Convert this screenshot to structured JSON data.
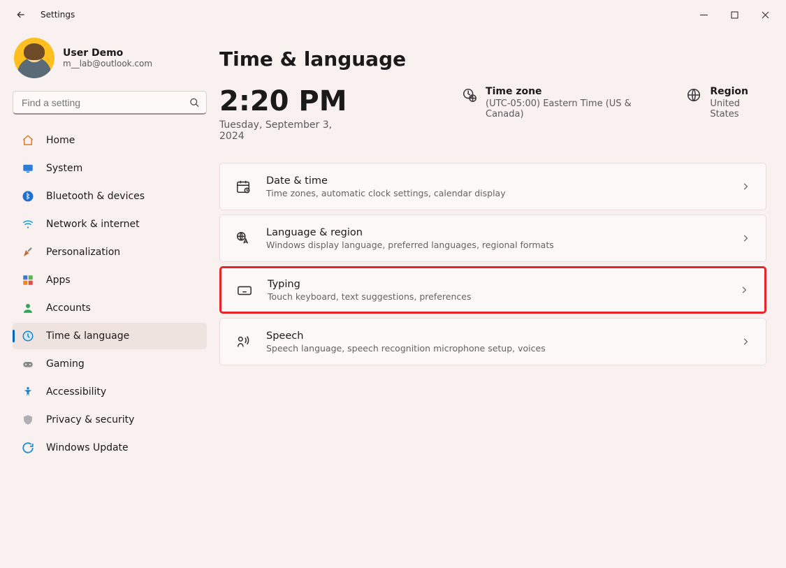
{
  "window": {
    "title": "Settings"
  },
  "user": {
    "name": "User Demo",
    "email": "m__lab@outlook.com"
  },
  "search": {
    "placeholder": "Find a setting"
  },
  "nav": {
    "items": [
      {
        "id": "home",
        "label": "Home"
      },
      {
        "id": "system",
        "label": "System"
      },
      {
        "id": "bluetooth",
        "label": "Bluetooth & devices"
      },
      {
        "id": "network",
        "label": "Network & internet"
      },
      {
        "id": "personalization",
        "label": "Personalization"
      },
      {
        "id": "apps",
        "label": "Apps"
      },
      {
        "id": "accounts",
        "label": "Accounts"
      },
      {
        "id": "time-language",
        "label": "Time & language"
      },
      {
        "id": "gaming",
        "label": "Gaming"
      },
      {
        "id": "accessibility",
        "label": "Accessibility"
      },
      {
        "id": "privacy",
        "label": "Privacy & security"
      },
      {
        "id": "update",
        "label": "Windows Update"
      }
    ]
  },
  "page": {
    "title": "Time & language",
    "time": "2:20 PM",
    "date": "Tuesday, September 3, 2024",
    "timezone": {
      "label": "Time zone",
      "value": "(UTC-05:00) Eastern Time (US & Canada)"
    },
    "region": {
      "label": "Region",
      "value": "United States"
    }
  },
  "cards": [
    {
      "id": "date-time",
      "title": "Date & time",
      "sub": "Time zones, automatic clock settings, calendar display"
    },
    {
      "id": "language-region",
      "title": "Language & region",
      "sub": "Windows display language, preferred languages, regional formats"
    },
    {
      "id": "typing",
      "title": "Typing",
      "sub": "Touch keyboard, text suggestions, preferences",
      "highlighted": true
    },
    {
      "id": "speech",
      "title": "Speech",
      "sub": "Speech language, speech recognition microphone setup, voices"
    }
  ]
}
